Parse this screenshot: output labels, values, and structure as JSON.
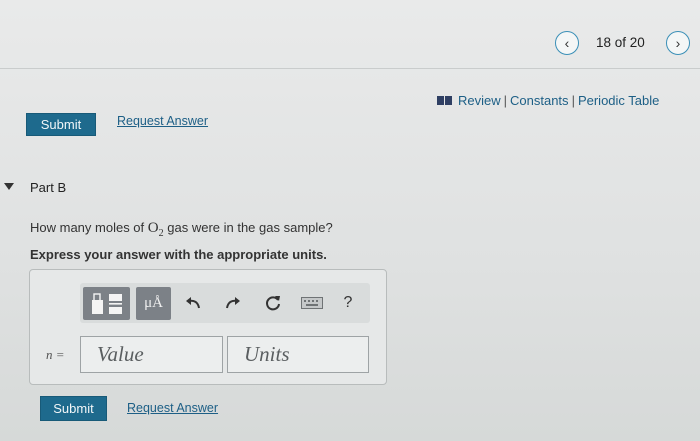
{
  "header": {
    "prev_icon": "chevron-left-icon",
    "next_icon": "chevron-right-icon",
    "pager_text": "18 of 20"
  },
  "resources": {
    "icon": "book-icon",
    "review": "Review",
    "constants": "Constants",
    "periodic_table": "Periodic Table",
    "separator": "|"
  },
  "part_a": {
    "submit_label": "Submit",
    "request_label": "Request Answer"
  },
  "part_b": {
    "title": "Part B",
    "question_before": "How many moles of",
    "question_chem": "O",
    "question_sub": "2",
    "question_after": "gas were in the gas sample?",
    "instruction": "Express your answer with the appropriate units.",
    "toolbar": {
      "units_label": "μÅ",
      "help_label": "?",
      "icons": [
        "templates-icon",
        "units-icon",
        "undo-icon",
        "redo-icon",
        "reset-icon",
        "keyboard-icon",
        "help-icon"
      ]
    },
    "variable_label": "n =",
    "value_placeholder": "Value",
    "units_placeholder": "Units",
    "submit_label": "Submit",
    "request_label": "Request Answer"
  },
  "colors": {
    "accent": "#1e6a8d",
    "link": "#1d5f86",
    "toolbar_button": "#7c8187"
  }
}
